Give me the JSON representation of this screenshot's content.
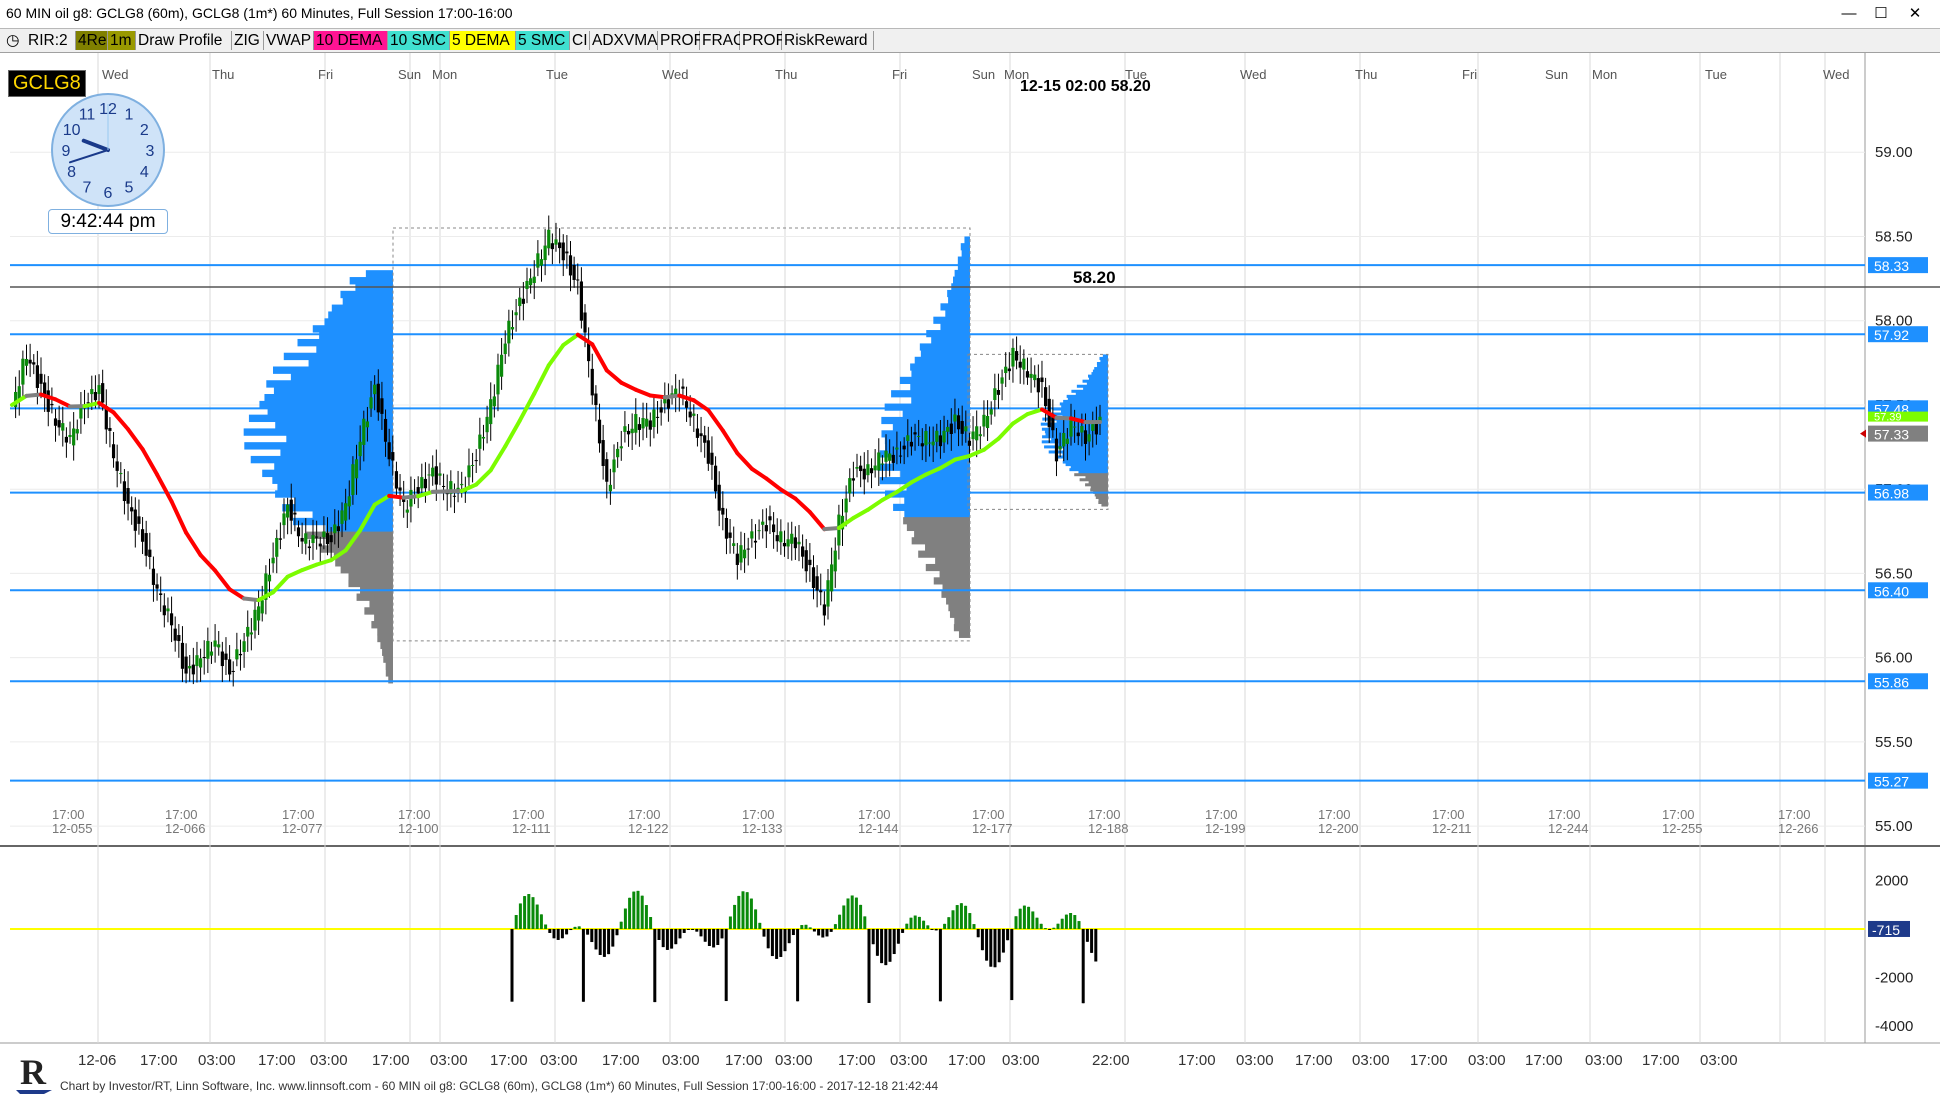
{
  "window": {
    "title": "60 MIN oil g8: GCLG8 (60m), GCLG8 (1m*) 60 Minutes, Full Session 17:00-16:00",
    "buttons": [
      "—",
      "☐",
      "✕"
    ]
  },
  "toolbar": [
    {
      "label": "RIR:2",
      "bg": "#f0f0f0"
    },
    {
      "label": "4Re",
      "bg": "#808000"
    },
    {
      "label": "1m",
      "bg": "#999900"
    },
    {
      "label": "Draw Profile",
      "bg": "#f0f0f0"
    },
    {
      "label": "ZIG",
      "bg": "#f0f0f0"
    },
    {
      "label": "VWAP",
      "bg": "#f0f0f0"
    },
    {
      "label": "10 DEMA",
      "bg": "#ff1493"
    },
    {
      "label": "10 SMC",
      "bg": "#40e0d0"
    },
    {
      "label": "5 DEMA",
      "bg": "#ffff00"
    },
    {
      "label": "5 SMC",
      "bg": "#40e0d0"
    },
    {
      "label": "CI",
      "bg": "#f0f0f0"
    },
    {
      "label": "ADXVMA",
      "bg": "#f0f0f0"
    },
    {
      "label": "PROF",
      "bg": "#f0f0f0"
    },
    {
      "label": "FRAC",
      "bg": "#f0f0f0"
    },
    {
      "label": "PROF",
      "bg": "#f0f0f0"
    },
    {
      "label": "RiskReward",
      "bg": "#f0f0f0"
    }
  ],
  "symbol": "GCLG8",
  "clock": {
    "time": "9:42:44 pm",
    "hour": 9,
    "minute": 42
  },
  "chart_data": [
    {
      "type": "candlestick",
      "title": "60 MIN oil g8: GCLG8 (60m)",
      "ylim": [
        54.9,
        59.5
      ],
      "yticks": [
        55.0,
        55.5,
        56.0,
        56.5,
        57.0,
        57.5,
        58.0,
        58.5,
        59.0
      ],
      "ytick_labels": [
        "55.00",
        "55.50",
        "56.00",
        "56.50",
        "57.00",
        "57.50",
        "58.00",
        "58.50",
        "59.00"
      ],
      "day_labels": [
        "Wed",
        "Thu",
        "Fri",
        "Sun",
        "Mon",
        "Tue",
        "Wed",
        "Thu",
        "Fri",
        "Sun",
        "Mon",
        "Tue",
        "Wed",
        "Thu",
        "Fri",
        "Sun",
        "Mon",
        "Tue",
        "Wed"
      ],
      "session_labels": [
        {
          "time": "17:00",
          "bar": "12-055"
        },
        {
          "time": "17:00",
          "bar": "12-066"
        },
        {
          "time": "17:00",
          "bar": "12-077"
        },
        {
          "time": "17:00",
          "bar": "12-100"
        },
        {
          "time": "17:00",
          "bar": "12-111"
        },
        {
          "time": "17:00",
          "bar": "12-122"
        },
        {
          "time": "17:00",
          "bar": "12-133"
        },
        {
          "time": "17:00",
          "bar": "12-144"
        },
        {
          "time": "17:00",
          "bar": "12-177"
        },
        {
          "time": "17:00",
          "bar": "12-188"
        },
        {
          "time": "17:00",
          "bar": "12-199"
        },
        {
          "time": "17:00",
          "bar": "12-200"
        },
        {
          "time": "17:00",
          "bar": "12-211"
        },
        {
          "time": "17:00",
          "bar": "12-244"
        },
        {
          "time": "17:00",
          "bar": "12-255"
        },
        {
          "time": "17:00",
          "bar": "12-266"
        }
      ],
      "horizontal_levels": [
        {
          "value": 58.33,
          "label": "58.33",
          "color": "#1e90ff"
        },
        {
          "value": 57.92,
          "label": "57.92",
          "color": "#1e90ff"
        },
        {
          "value": 57.48,
          "label": "57.48",
          "color": "#1e90ff"
        },
        {
          "value": 56.98,
          "label": "56.98",
          "color": "#1e90ff"
        },
        {
          "value": 56.4,
          "label": "56.40",
          "color": "#1e90ff"
        },
        {
          "value": 55.86,
          "label": "55.86",
          "color": "#1e90ff"
        },
        {
          "value": 55.27,
          "label": "55.27",
          "color": "#1e90ff"
        }
      ],
      "reference_line": {
        "value": 58.2,
        "label": "58.20",
        "color": "#555555"
      },
      "hover_readout": "12-15 02:00 58.20",
      "last_price": {
        "value": 57.33,
        "label": "57.33"
      },
      "tag_overlap": {
        "label": "57.39"
      },
      "price_path": [
        57.5,
        57.8,
        57.6,
        57.4,
        57.3,
        57.5,
        57.6,
        57.2,
        56.9,
        56.7,
        56.4,
        56.2,
        55.9,
        56.0,
        56.1,
        55.9,
        56.1,
        56.3,
        56.6,
        56.9,
        56.7,
        56.7,
        56.7,
        56.9,
        57.3,
        57.6,
        57.2,
        56.9,
        57.0,
        57.1,
        57.0,
        57.0,
        57.2,
        57.5,
        57.9,
        58.1,
        58.3,
        58.5,
        58.4,
        58.2,
        57.6,
        57.0,
        57.3,
        57.4,
        57.4,
        57.5,
        57.6,
        57.4,
        57.2,
        56.8,
        56.6,
        56.7,
        56.8,
        56.7,
        56.7,
        56.5,
        56.3,
        56.8,
        57.1,
        57.1,
        57.2,
        57.2,
        57.3,
        57.3,
        57.3,
        57.4,
        57.3,
        57.4,
        57.6,
        57.8,
        57.7,
        57.6,
        57.2,
        57.4,
        57.3,
        57.4
      ]
    },
    {
      "type": "oscillator",
      "title": "indicator panel",
      "yticks": [
        2000,
        0,
        -2000,
        -4000
      ],
      "ytick_labels": [
        "2000",
        "0",
        "-2000",
        "-4000"
      ],
      "ylim": [
        -4500,
        3300
      ],
      "zero_line_color": "#ffff00",
      "last_value": {
        "label": "-715"
      },
      "x_labels": [
        "12-06",
        "17:00",
        "03:00",
        "17:00",
        "03:00",
        "17:00",
        "03:00",
        "17:00",
        "03:00",
        "17:00",
        "03:00",
        "17:00",
        "03:00",
        "17:00",
        "03:00",
        "17:00",
        "03:00",
        "22:00",
        "17:00",
        "03:00",
        "17:00",
        "03:00",
        "17:00",
        "03:00",
        "17:00",
        "03:00",
        "17:00",
        "03:00"
      ]
    }
  ],
  "footer": "Chart by Investor/RT, Linn Software, Inc. www.linnsoft.com - 60 MIN oil g8: GCLG8 (60m), GCLG8 (1m*) 60 Minutes, Full Session 17:00-16:00 - 2017-12-18 21:42:44"
}
